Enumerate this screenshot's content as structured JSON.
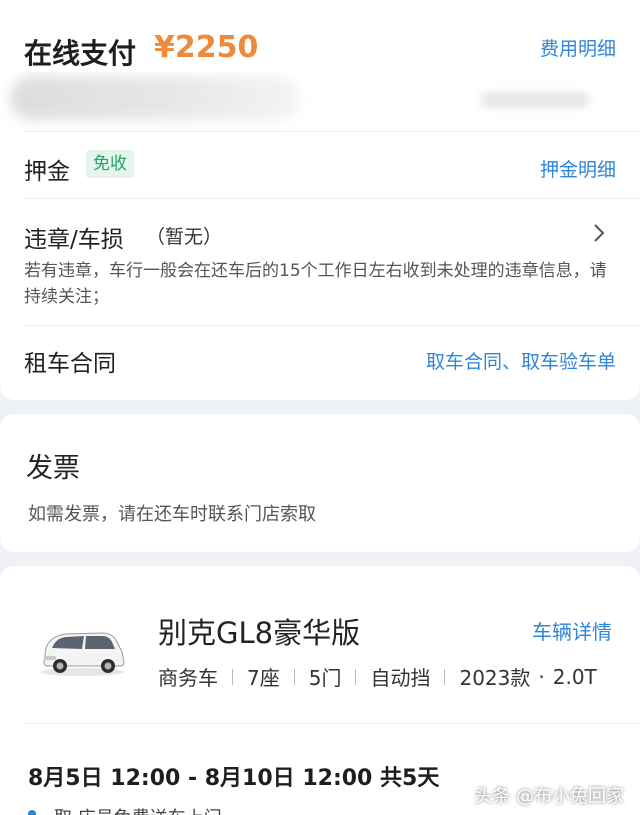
{
  "payment": {
    "label": "在线支付",
    "amount": "¥2250",
    "fee_detail": "费用明细"
  },
  "deposit": {
    "label": "押金",
    "badge": "免收",
    "detail": "押金明细"
  },
  "violation": {
    "title": "违章/车损",
    "status": "（暂无）",
    "description": "若有违章，车行一般会在还车后的15个工作日左右收到未处理的违章信息，请持续关注；"
  },
  "contract": {
    "label": "租车合同",
    "links": "取车合同、取车验车单"
  },
  "invoice": {
    "title": "发票",
    "description": "如需发票，请在还车时联系门店索取"
  },
  "car": {
    "name": "别克GL8豪华版",
    "detail_link": "车辆详情",
    "specs": [
      "商务车",
      "7座",
      "5门",
      "自动挡",
      "2023款"
    ],
    "engine": "2.0T"
  },
  "rental": {
    "date_range": "8月5日 12:00 - 8月10日 12:00  共5天",
    "cut_line": "取  店员免费送车上门"
  },
  "watermark": "头条 @布小兔回家",
  "icons": {
    "chevron": "chevron-right-icon",
    "car": "car-image"
  },
  "colors": {
    "accent": "#2f86d8",
    "price": "#ef8a3a",
    "badge_text": "#27a268",
    "badge_bg": "#e3f5ec"
  }
}
